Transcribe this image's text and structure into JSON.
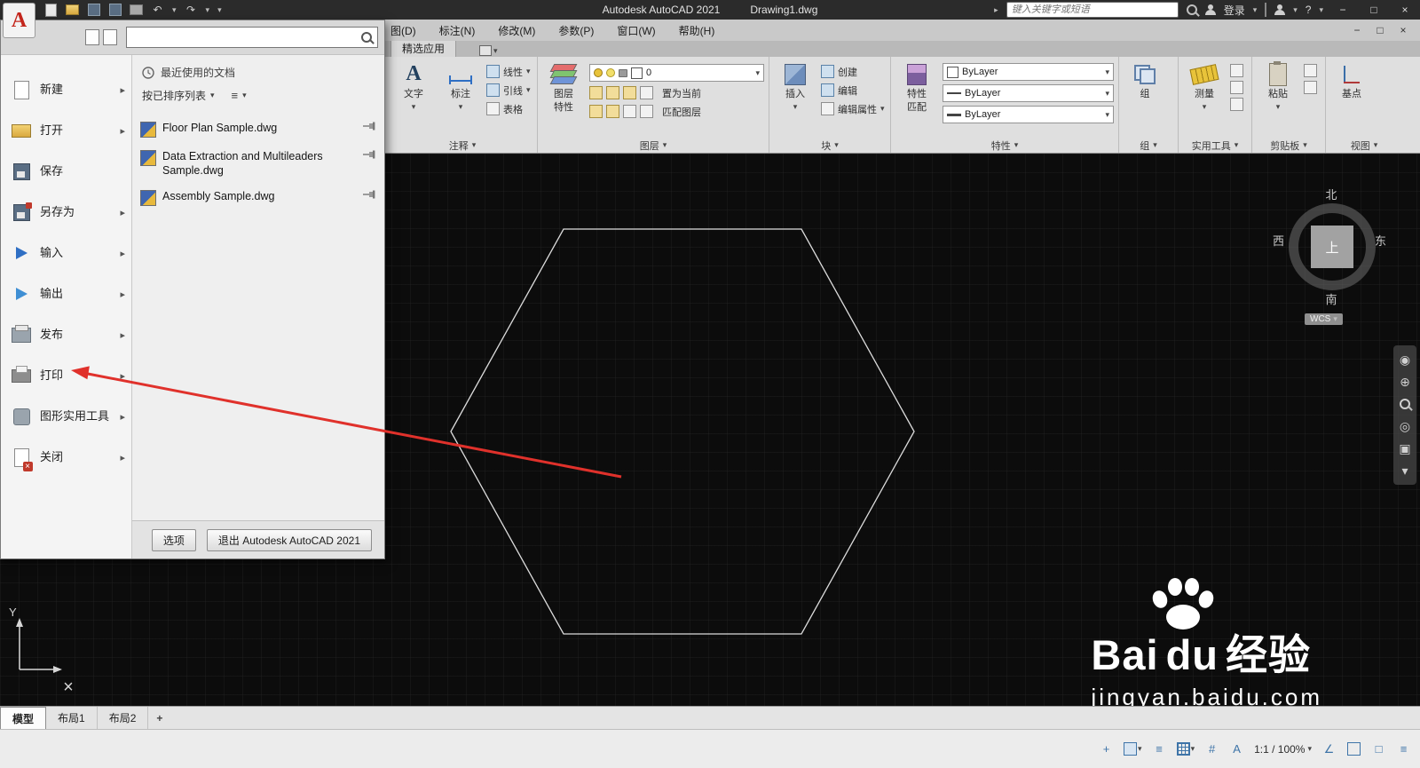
{
  "icons": {
    "caret_down": "▾",
    "arrow_right": "▸",
    "minimize": "−",
    "maximize": "□",
    "close": "×",
    "undo": "↶",
    "redo": "↷",
    "question": "?",
    "hamburger": "≡",
    "plus": "+",
    "angle": "∠",
    "grid_hash": "#",
    "crosshair": "+",
    "letter_a": "A",
    "orbit": "◎",
    "target": "⊕",
    "wheel": "◉",
    "refresh": "↻",
    "square": "▣"
  },
  "titlebar": {
    "app_title": "Autodesk AutoCAD 2021",
    "doc_title": "Drawing1.dwg",
    "search_placeholder": "键入关键字或短语",
    "signin": "登录"
  },
  "menubar": {
    "items": [
      "图(D)",
      "标注(N)",
      "修改(M)",
      "参数(P)",
      "窗口(W)",
      "帮助(H)"
    ]
  },
  "ribbon": {
    "featured_tab": "精选应用",
    "panels": {
      "annotate": {
        "label": "注释",
        "text": "文字",
        "dim": "标注",
        "rows": [
          "线性",
          "引线",
          "表格"
        ]
      },
      "layers": {
        "label": "图层",
        "props_line1": "图层",
        "props_line2": "特性",
        "combo": "0",
        "set_current": "置为当前",
        "match": "匹配图层"
      },
      "block": {
        "label": "块",
        "insert": "插入",
        "create": "创建",
        "edit": "编辑",
        "edit_attr": "编辑属性"
      },
      "properties": {
        "label": "特性",
        "match_line1": "特性",
        "match_line2": "匹配",
        "color": "ByLayer",
        "linetype": "ByLayer",
        "lineweight": "ByLayer"
      },
      "groups": {
        "label": "组",
        "group": "组"
      },
      "utilities": {
        "label": "实用工具",
        "measure": "测量"
      },
      "clipboard": {
        "label": "剪贴板",
        "paste": "粘贴"
      },
      "view": {
        "label": "视图",
        "base": "基点"
      }
    }
  },
  "app_menu": {
    "recent_header": "最近使用的文档",
    "sort_label": "按已排序列表",
    "items": [
      {
        "label": "新建"
      },
      {
        "label": "打开"
      },
      {
        "label": "保存"
      },
      {
        "label": "另存为"
      },
      {
        "label": "输入"
      },
      {
        "label": "输出"
      },
      {
        "label": "发布"
      },
      {
        "label": "打印"
      },
      {
        "label": "图形实用工具"
      },
      {
        "label": "关闭"
      }
    ],
    "files": [
      {
        "name": "Floor Plan Sample.dwg"
      },
      {
        "name": "Data Extraction and Multileaders Sample.dwg"
      },
      {
        "name": "Assembly Sample.dwg"
      }
    ],
    "options": "选项",
    "exit": "退出 Autodesk AutoCAD 2021"
  },
  "viewcube": {
    "n": "北",
    "s": "南",
    "e": "东",
    "w": "西",
    "top": "上",
    "wcs": "WCS"
  },
  "drawing": {
    "ucs_y": "Y"
  },
  "tabs": {
    "model": "模型",
    "layout1": "布局1",
    "layout2": "布局2",
    "add": "+"
  },
  "statusbar": {
    "scale": "1:1 / 100%"
  },
  "watermark": {
    "brand_a": "Bai",
    "brand_b": "du",
    "brand_cn": "经验",
    "url": "jingyan.baidu.com"
  },
  "colors": {
    "arrow_red": "#e0312b",
    "hexagon_stroke": "#dcdcdc"
  }
}
